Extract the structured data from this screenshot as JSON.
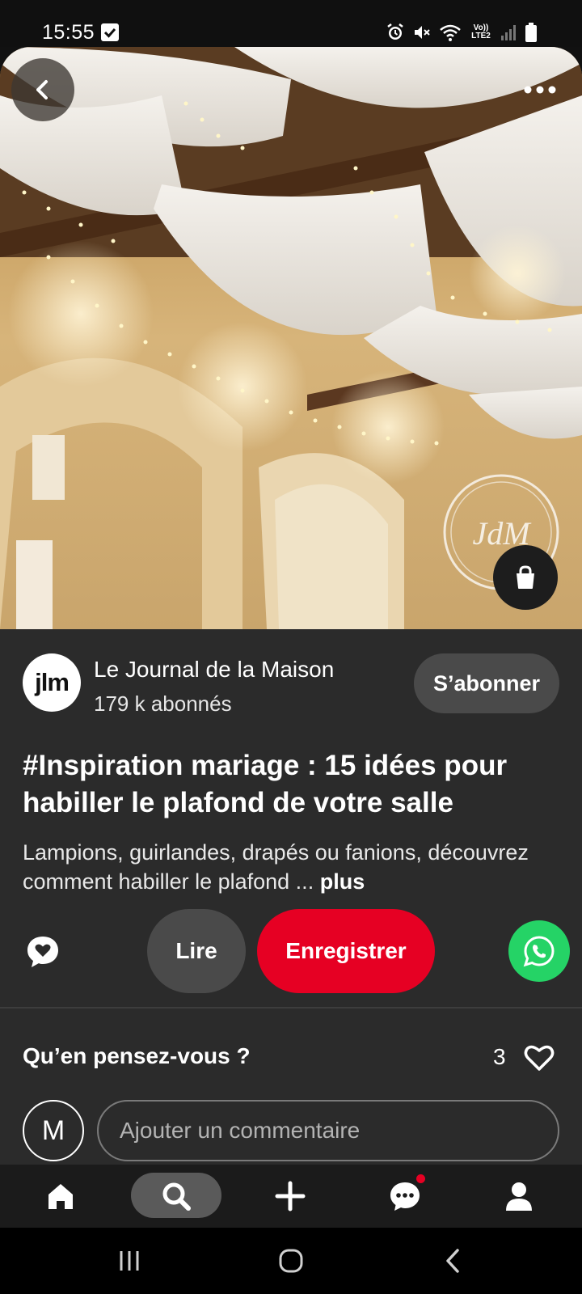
{
  "status_bar": {
    "time": "15:55",
    "network_label": "Vo)) LTE2"
  },
  "hero": {
    "watermark_text": "JdM"
  },
  "publisher": {
    "avatar_text": "jlm",
    "name": "Le Journal de la Maison",
    "followers": "179 k abonnés",
    "subscribe_label": "S’abonner"
  },
  "pin": {
    "title": "#Inspiration mariage : 15 idées pour habiller le plafond de votre salle",
    "description": "Lampions, guirlandes, drapés ou fanions, découvrez comment habiller le plafond ...",
    "more_label": "plus"
  },
  "actions": {
    "read_label": "Lire",
    "save_label": "Enregistrer"
  },
  "comments": {
    "question": "Qu’en pensez-vous ?",
    "like_count": "3",
    "user_initial": "M",
    "input_placeholder": "Ajouter un commentaire"
  },
  "icons": {
    "back": "chevron-left-icon",
    "more": "more-dots-icon",
    "bag": "shopping-bag-icon",
    "react": "heart-bubble-icon",
    "share": "whatsapp-icon",
    "heart": "heart-outline-icon",
    "nav": [
      "home-icon",
      "search-icon",
      "plus-icon",
      "messages-icon",
      "profile-icon"
    ]
  },
  "colors": {
    "accent_red": "#e60023",
    "whatsapp_green": "#25d366",
    "panel_bg": "#2b2b2b"
  }
}
